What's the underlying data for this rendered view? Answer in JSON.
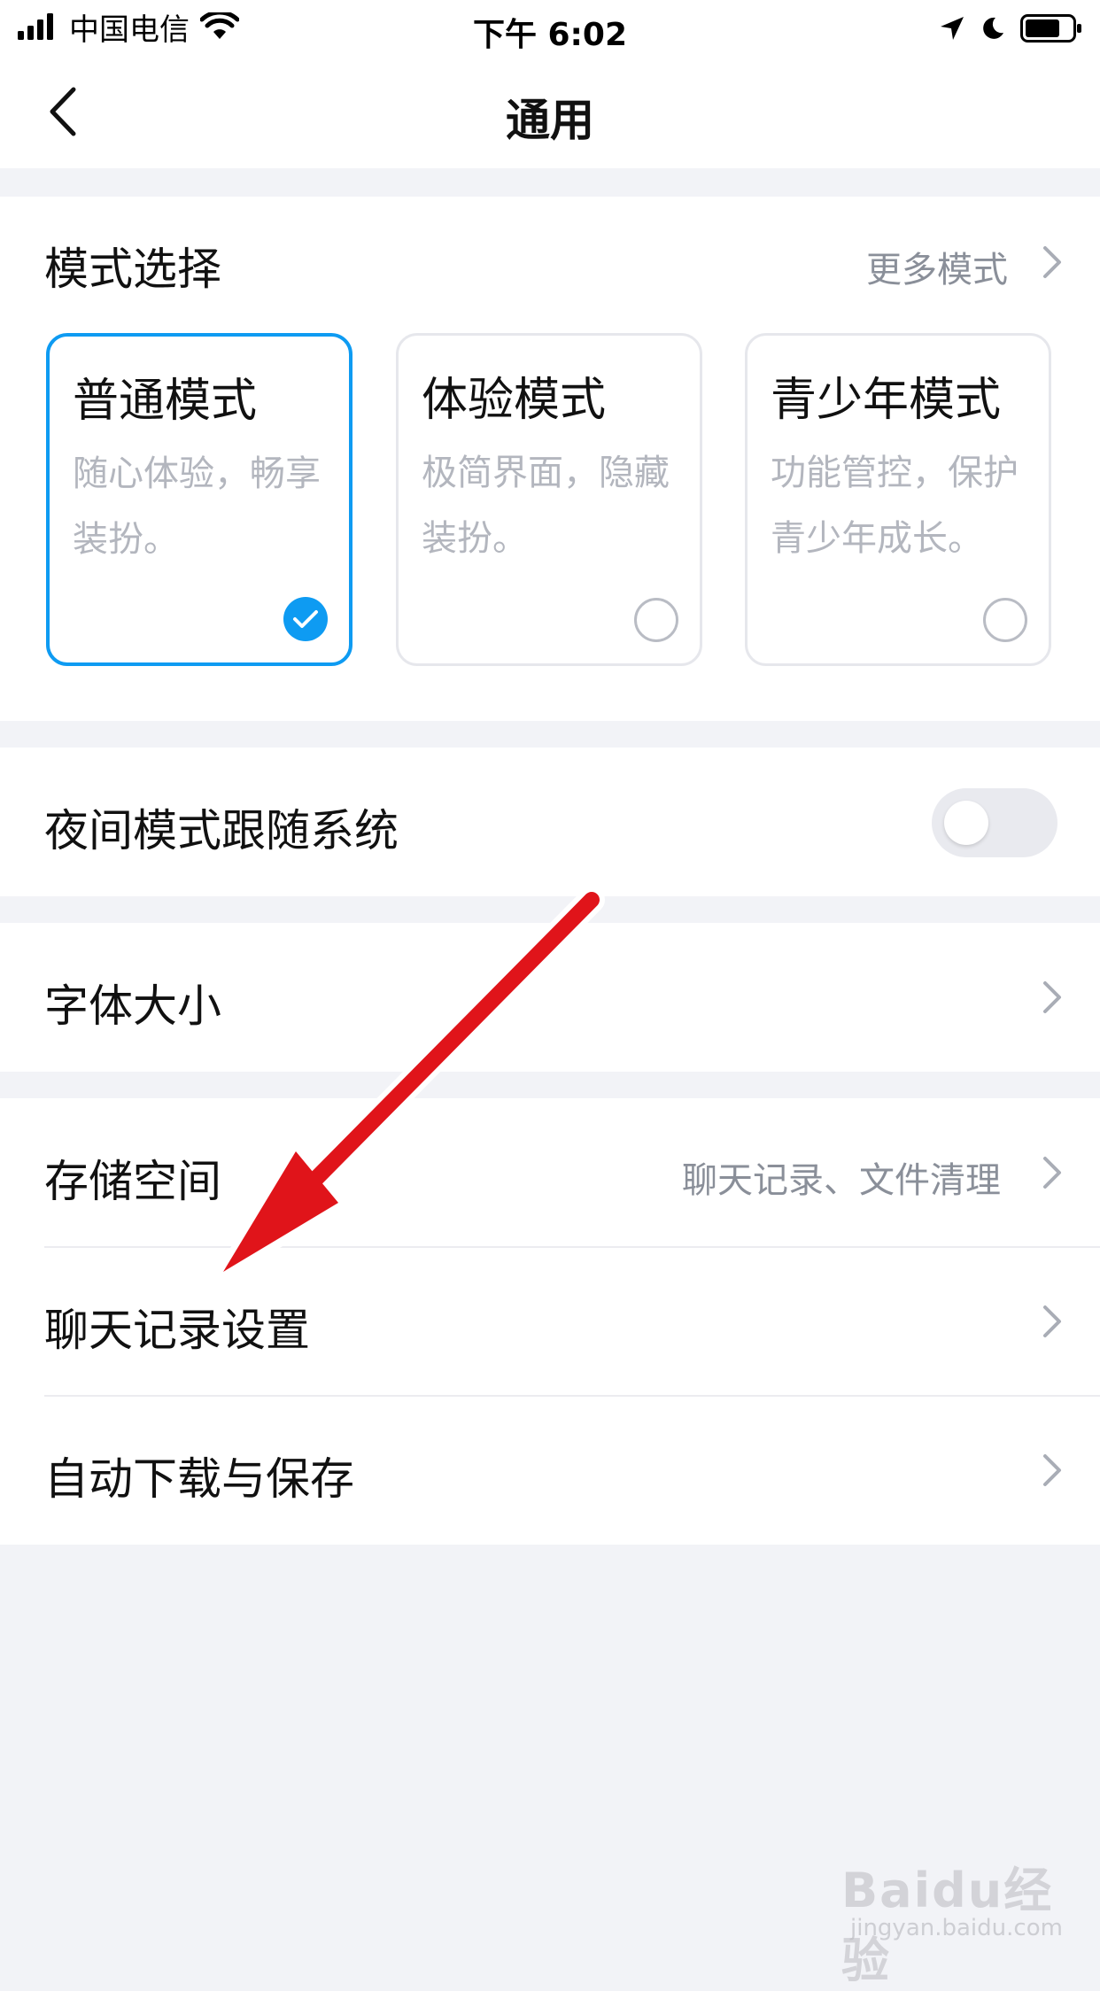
{
  "status_bar": {
    "carrier": "中国电信",
    "time": "下午 6:02",
    "icons": [
      "signal-icon",
      "wifi-icon",
      "location-icon",
      "moon-icon",
      "battery-icon"
    ]
  },
  "nav": {
    "title": "通用",
    "back_icon": "chevron-left-icon"
  },
  "mode_section": {
    "title": "模式选择",
    "more_label": "更多模式",
    "modes": [
      {
        "title": "普通模式",
        "desc_line1": "随心体验，畅享",
        "desc_line2": "装扮。",
        "selected": true
      },
      {
        "title": "体验模式",
        "desc_line1": "极简界面，隐藏",
        "desc_line2": "装扮。",
        "selected": false
      },
      {
        "title": "青少年模式",
        "desc_line1": "功能管控，保护",
        "desc_line2": "青少年成长。",
        "selected": false
      }
    ]
  },
  "night_mode": {
    "label": "夜间模式跟随系统",
    "enabled": false
  },
  "font_size": {
    "label": "字体大小"
  },
  "storage": {
    "label": "存储空间",
    "value": "聊天记录、文件清理"
  },
  "chat_history": {
    "label": "聊天记录设置"
  },
  "auto_download": {
    "label": "自动下载与保存"
  },
  "watermark": {
    "text": "Baidu经验",
    "url": "jingyan.baidu.com"
  },
  "colors": {
    "accent": "#0e9bf2",
    "arrow": "#e0141a",
    "background": "#f2f3f7"
  }
}
